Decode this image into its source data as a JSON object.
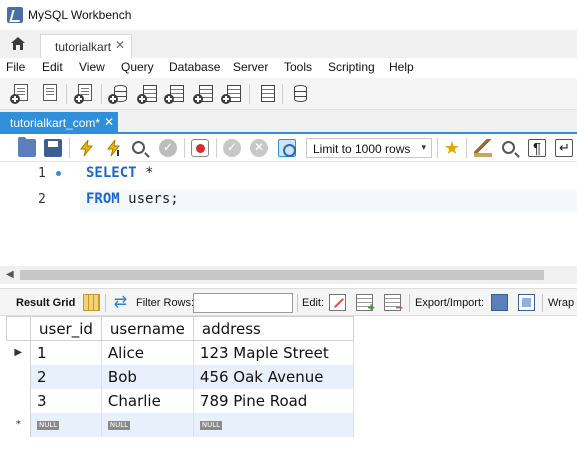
{
  "window": {
    "title": "MySQL Workbench"
  },
  "connection_tab": {
    "label": "tutorialkart",
    "close_glyph": "✕"
  },
  "menu": [
    "File",
    "Edit",
    "View",
    "Query",
    "Database",
    "Server",
    "Tools",
    "Scripting",
    "Help"
  ],
  "editor_tab": {
    "label": "tutorialkart_com*",
    "close_glyph": "✕"
  },
  "sql_toolbar": {
    "limit_label": "Limit to 1000 rows",
    "limit_caret": "▾"
  },
  "editor": {
    "line_numbers": [
      "1",
      "2"
    ],
    "lines": [
      {
        "keyword": "SELECT",
        "rest": " *"
      },
      {
        "keyword": "FROM",
        "rest": " users;"
      }
    ]
  },
  "result_toolbar": {
    "result_grid_label": "Result Grid",
    "filter_label": "Filter Rows:",
    "filter_value": "",
    "edit_label": "Edit:",
    "export_import_label": "Export/Import:",
    "wrap_label": "Wrap"
  },
  "results": {
    "columns": [
      "user_id",
      "username",
      "address"
    ],
    "rows": [
      [
        "1",
        "Alice",
        "123 Maple Street"
      ],
      [
        "2",
        "Bob",
        "456 Oak Avenue"
      ],
      [
        "3",
        "Charlie",
        "789 Pine Road"
      ]
    ],
    "new_row_marker": "*",
    "null_label": "NULL",
    "current_row_marker": "▶"
  },
  "icons": {
    "home": "home-icon",
    "new_tab": "new-sql-tab-icon",
    "open_sql": "open-sql-script-icon",
    "inspector": "inspector-icon",
    "create_schema": "create-schema-icon",
    "create_table": "create-table-icon",
    "execute": "lightning-icon",
    "stop": "stop-icon",
    "beautify": "brush-icon"
  },
  "colors": {
    "accent": "#2f8fd8",
    "keyword": "#1e66c8",
    "alt_row": "#e8f0fb"
  }
}
